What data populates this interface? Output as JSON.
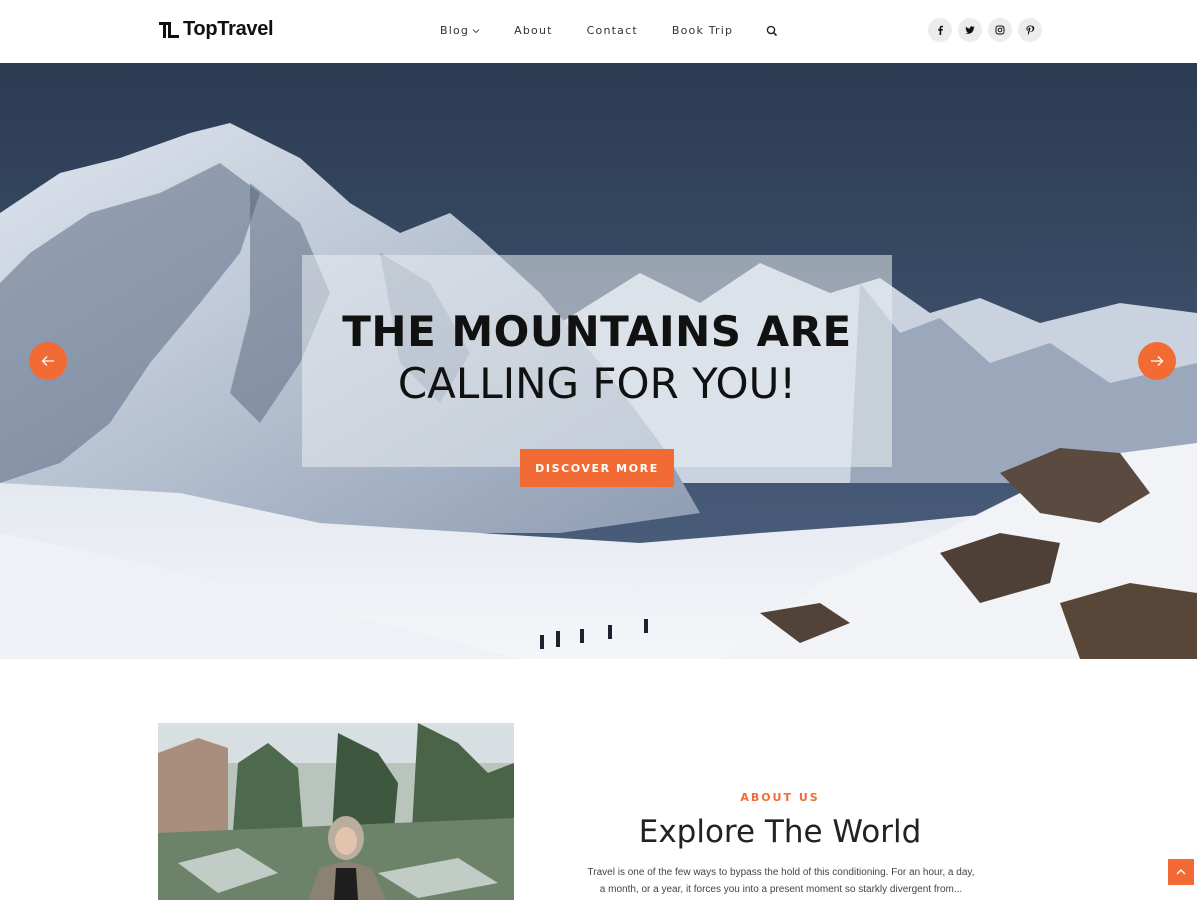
{
  "brand": {
    "name": "TopTravel",
    "accent_color": "#f26b34"
  },
  "nav": {
    "items": [
      {
        "label": "Blog",
        "has_dropdown": true
      },
      {
        "label": "About"
      },
      {
        "label": "Contact"
      },
      {
        "label": "Book Trip"
      }
    ],
    "search_icon": "search-icon"
  },
  "social": [
    {
      "icon": "facebook-icon"
    },
    {
      "icon": "twitter-icon"
    },
    {
      "icon": "instagram-icon"
    },
    {
      "icon": "pinterest-icon"
    }
  ],
  "hero": {
    "title_line1": "THE MOUNTAINS ARE",
    "title_line2": "CALLING FOR YOU!",
    "button_label": "DISCOVER MORE",
    "prev_icon": "arrow-left-icon",
    "next_icon": "arrow-right-icon"
  },
  "about": {
    "eyebrow": "ABOUT US",
    "title": "Explore The World",
    "text": "Travel is one of the few ways to bypass the hold of this conditioning. For an hour, a day, a month, or a year, it forces you into a present moment so starkly divergent from..."
  },
  "back_to_top_icon": "chevron-up-icon"
}
